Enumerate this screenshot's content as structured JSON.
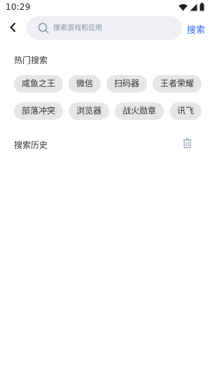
{
  "status_bar": {
    "time": "10:29",
    "icons": [
      "wifi-icon",
      "signal-icon",
      "battery-icon"
    ]
  },
  "header": {
    "back_icon": "chevron-left-icon",
    "search_icon": "search-icon",
    "search_placeholder": "搜索游戏和应用",
    "search_value": "",
    "search_button_label": "搜索"
  },
  "hot_search": {
    "title": "热门搜索",
    "rows": [
      [
        "咸鱼之王",
        "微信",
        "扫码器",
        "王者荣耀"
      ],
      [
        "部落冲突",
        "浏览器",
        "战火勋章",
        "讯飞"
      ]
    ]
  },
  "history": {
    "title": "搜索历史",
    "clear_icon": "trash-icon"
  },
  "colors": {
    "accent": "#2f6df5",
    "chip_bg": "#e6e6e6",
    "search_bg": "#eef0f6",
    "text": "#333333"
  }
}
